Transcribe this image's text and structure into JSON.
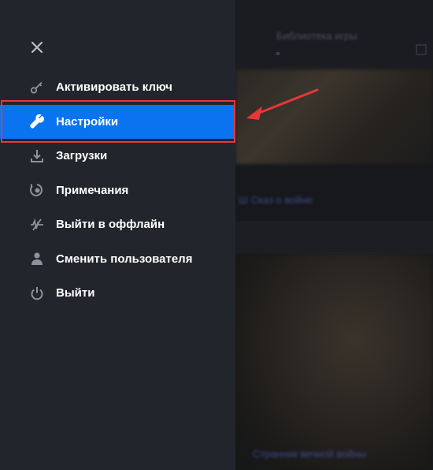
{
  "background": {
    "header_text": "Библиотека игры",
    "banner1_caption": "Ш Сказ о войне",
    "banner2_caption": "Странник вечной войны"
  },
  "menu": {
    "close_icon": "close-icon",
    "items": [
      {
        "label": "Активировать ключ",
        "icon": "key-icon",
        "active": false
      },
      {
        "label": "Настройки",
        "icon": "wrench-icon",
        "active": true
      },
      {
        "label": "Загрузки",
        "icon": "download-icon",
        "active": false
      },
      {
        "label": "Примечания",
        "icon": "notes-icon",
        "active": false
      },
      {
        "label": "Выйти в оффлайн",
        "icon": "offline-icon",
        "active": false
      },
      {
        "label": "Сменить пользователя",
        "icon": "user-icon",
        "active": false
      },
      {
        "label": "Выйти",
        "icon": "power-icon",
        "active": false
      }
    ]
  },
  "colors": {
    "sidebar_bg": "#22252b",
    "active_bg": "#0a74f0",
    "annotation_red": "#e8373b"
  }
}
